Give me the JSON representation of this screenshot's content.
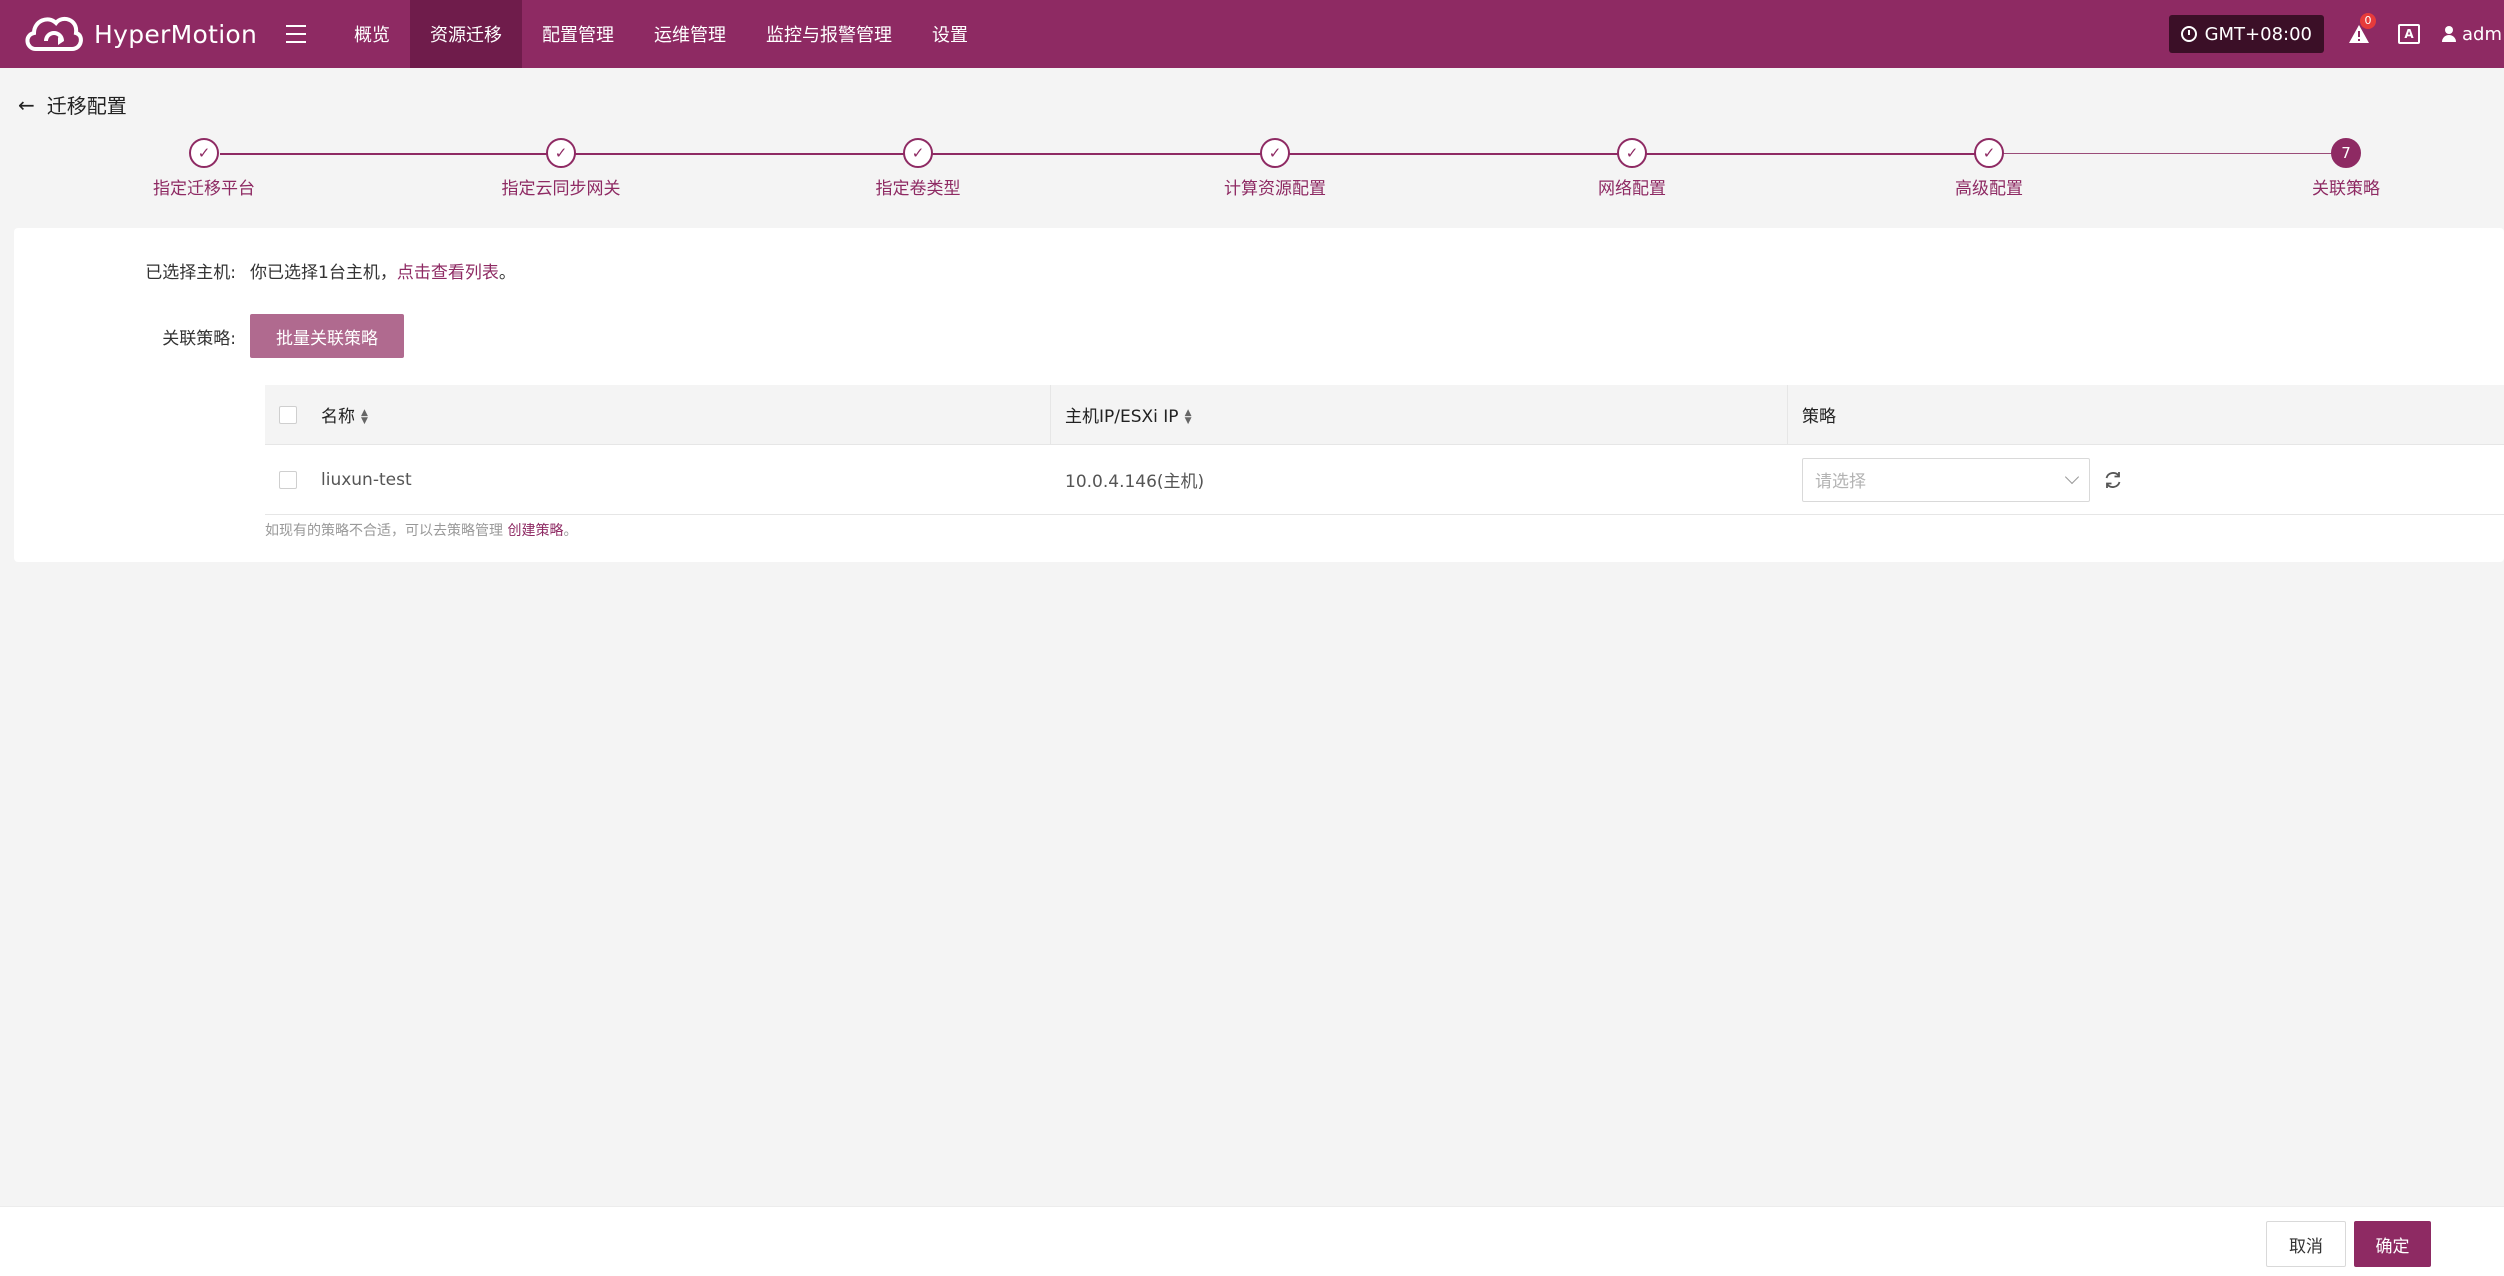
{
  "app": {
    "name": "HyperMotion",
    "nav": [
      {
        "label": "概览"
      },
      {
        "label": "资源迁移"
      },
      {
        "label": "配置管理"
      },
      {
        "label": "运维管理"
      },
      {
        "label": "监控与报警管理"
      },
      {
        "label": "设置"
      }
    ],
    "active_nav": "资源迁移",
    "timezone": "GMT+08:00",
    "alert_count": "0",
    "lang_icon": "A",
    "user": "adm",
    "brand_color": "#8e2a63"
  },
  "page": {
    "title": "迁移配置"
  },
  "steps": [
    {
      "label": "指定迁移平台",
      "status": "done",
      "mark": "✓"
    },
    {
      "label": "指定云同步网关",
      "status": "done",
      "mark": "✓"
    },
    {
      "label": "指定卷类型",
      "status": "done",
      "mark": "✓"
    },
    {
      "label": "计算资源配置",
      "status": "done",
      "mark": "✓"
    },
    {
      "label": "网络配置",
      "status": "done",
      "mark": "✓"
    },
    {
      "label": "高级配置",
      "status": "done",
      "mark": "✓"
    },
    {
      "label": "关联策略",
      "status": "current",
      "mark": "7"
    }
  ],
  "form": {
    "selected_label": "已选择主机:",
    "selected_prefix": "你已选择",
    "selected_count": "1",
    "selected_suffix": "台主机，",
    "selected_link": "点击查看列表",
    "selected_end": "。",
    "strategy_label": "关联策略:",
    "batch_button": "批量关联策略"
  },
  "table": {
    "columns": [
      "名称",
      "主机IP/ESXi IP",
      "策略"
    ],
    "rows": [
      {
        "name": "liuxun-test",
        "ip": "10.0.4.146(主机)",
        "strategy_placeholder": "请选择"
      }
    ],
    "hint_text": "如现有的策略不合适，可以去策略管理 ",
    "hint_link": "创建策略",
    "hint_end": "。"
  },
  "footer": {
    "cancel": "取消",
    "ok": "确定"
  }
}
